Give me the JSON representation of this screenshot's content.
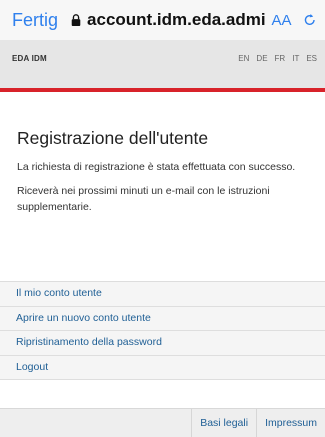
{
  "browser": {
    "done_label": "Fertig",
    "url": "account.idm.eda.admin.",
    "aa_label": "AA"
  },
  "site": {
    "brand": "EDA IDM",
    "languages": [
      "EN",
      "DE",
      "FR",
      "IT",
      "ES"
    ]
  },
  "main": {
    "title": "Registrazione dell'utente",
    "paragraphs": [
      "La richiesta di registrazione è stata effettuata con successo.",
      "Riceverà nei prossimi minuti un e-mail con le istruzioni supplementarie."
    ]
  },
  "nav": {
    "items": [
      "Il mio conto utente",
      "Aprire un nuovo conto utente",
      "Ripristinamento della password",
      "Logout"
    ]
  },
  "footer": {
    "links": [
      "Basi legali",
      "Impressum"
    ]
  },
  "colors": {
    "accent": "#2f80ed",
    "brand_red": "#d8232a",
    "link": "#1f5f95"
  }
}
